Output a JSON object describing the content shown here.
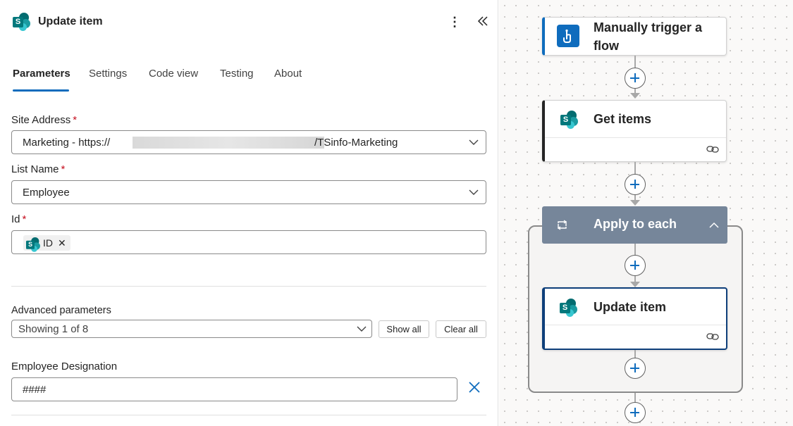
{
  "panel": {
    "title": "Update item",
    "tabs": [
      "Parameters",
      "Settings",
      "Code view",
      "Testing",
      "About"
    ],
    "site_address": {
      "label": "Site Address",
      "required_mark": "*",
      "value_prefix": "Marketing - https://",
      "value_suffix": "/TSinfo-Marketing"
    },
    "list_name": {
      "label": "List Name",
      "required_mark": "*",
      "value": "Employee"
    },
    "id_field": {
      "label": "Id",
      "required_mark": "*",
      "token": "ID",
      "token_remove": "✕"
    },
    "advanced": {
      "label": "Advanced parameters",
      "dropdown_value": "Showing 1 of 8",
      "show_all": "Show all",
      "clear_all": "Clear all"
    },
    "employee_designation": {
      "label": "Employee Designation",
      "value": "####"
    }
  },
  "canvas": {
    "nodes": {
      "trigger": "Manually trigger a flow",
      "get_items": "Get items",
      "apply_to_each": "Apply to each",
      "update_item": "Update item"
    }
  },
  "colors": {
    "accent": "#0f6cbd",
    "loop_header": "#76869a",
    "required": "#c50f1f",
    "sharepoint": "#03787c"
  },
  "icons": [
    "sharepoint-icon",
    "more-vertical-icon",
    "collapse-panel-icon",
    "chevron-down-icon",
    "close-icon",
    "hand-tap-icon",
    "link-icon",
    "loop-icon",
    "chevron-up-icon",
    "plus-icon"
  ]
}
